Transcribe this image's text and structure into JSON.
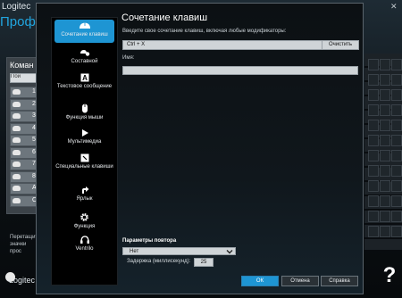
{
  "background": {
    "brand": "Logitec",
    "subtitle": "Проф",
    "panel_title": "Коман",
    "search_placeholder": "Пои",
    "commands": [
      "1",
      "2",
      "3",
      "4",
      "5",
      "6",
      "7",
      "8",
      "А",
      "С"
    ],
    "hint": "Перетащите значки прос",
    "footer_brand": "Logitec",
    "close": "✕",
    "help": "?"
  },
  "dialog": {
    "title": "Сочетание клавиш",
    "sidebar": [
      {
        "label": "Сочетание клавиш",
        "icon": "mouse-icon",
        "selected": true
      },
      {
        "label": "Составной",
        "icon": "multi-key-icon",
        "selected": false
      },
      {
        "label": "Текстовое сообщение",
        "icon": "text-a-icon",
        "selected": false
      },
      {
        "label": "Функция мыши",
        "icon": "mouse-button-icon",
        "selected": false
      },
      {
        "label": "Мультимедиа",
        "icon": "play-icon",
        "selected": false
      },
      {
        "label": "Специальные клавиши",
        "icon": "special-key-icon",
        "selected": false
      },
      {
        "label": "Ярлык",
        "icon": "shortcut-arrow-icon",
        "selected": false
      },
      {
        "label": "Функция",
        "icon": "gear-icon",
        "selected": false
      },
      {
        "label": "Ventrilo",
        "icon": "headset-icon",
        "selected": false
      }
    ],
    "keystroke_label": "Введите свое сочетание клавиш, включая любые модификаторы:",
    "keystroke_value": "Ctrl + X",
    "clear_label": "Очистить",
    "name_label": "Имя:",
    "name_value": "",
    "repeat_label": "Параметры повтора",
    "repeat_value": "Нет",
    "delay_label": "Задержка (миллисекунд):",
    "delay_value": "25",
    "ok_label": "ОК",
    "cancel_label": "Отмена",
    "help_label": "Справка"
  },
  "colors": {
    "accent": "#1e95d3",
    "dialog_bg": "#0c1013",
    "sidebar_bg": "#000000",
    "input_bg": "#cfd4d7"
  }
}
